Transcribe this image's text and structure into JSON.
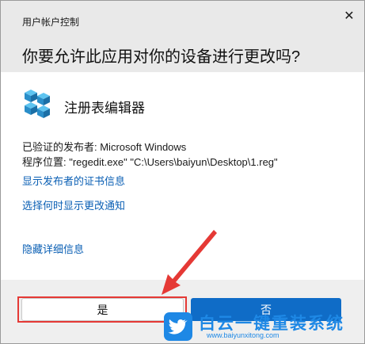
{
  "dialog": {
    "window_title": "用户帐户控制",
    "close_glyph": "✕",
    "question": "你要允许此应用对你的设备进行更改吗?",
    "app_name": "注册表编辑器",
    "app_icon": "regedit-icon",
    "publisher_line": "已验证的发布者: Microsoft Windows",
    "location_line": "程序位置: \"regedit.exe\" \"C:\\Users\\baiyun\\Desktop\\1.reg\"",
    "links": {
      "show_cert": "显示发布者的证书信息",
      "notify_time": "选择何时显示更改通知",
      "hide_details": "隐藏详细信息"
    },
    "buttons": {
      "yes": "是",
      "no": "否"
    },
    "colors": {
      "header_bg": "#e9e9e9",
      "link": "#0a5fb4",
      "primary_button": "#0f6cc7",
      "highlight": "#e53935"
    }
  },
  "watermark": {
    "title": "白云一键重装系统",
    "url": "www.baiyunxitong.com",
    "icon": "twitter-bird-icon"
  }
}
